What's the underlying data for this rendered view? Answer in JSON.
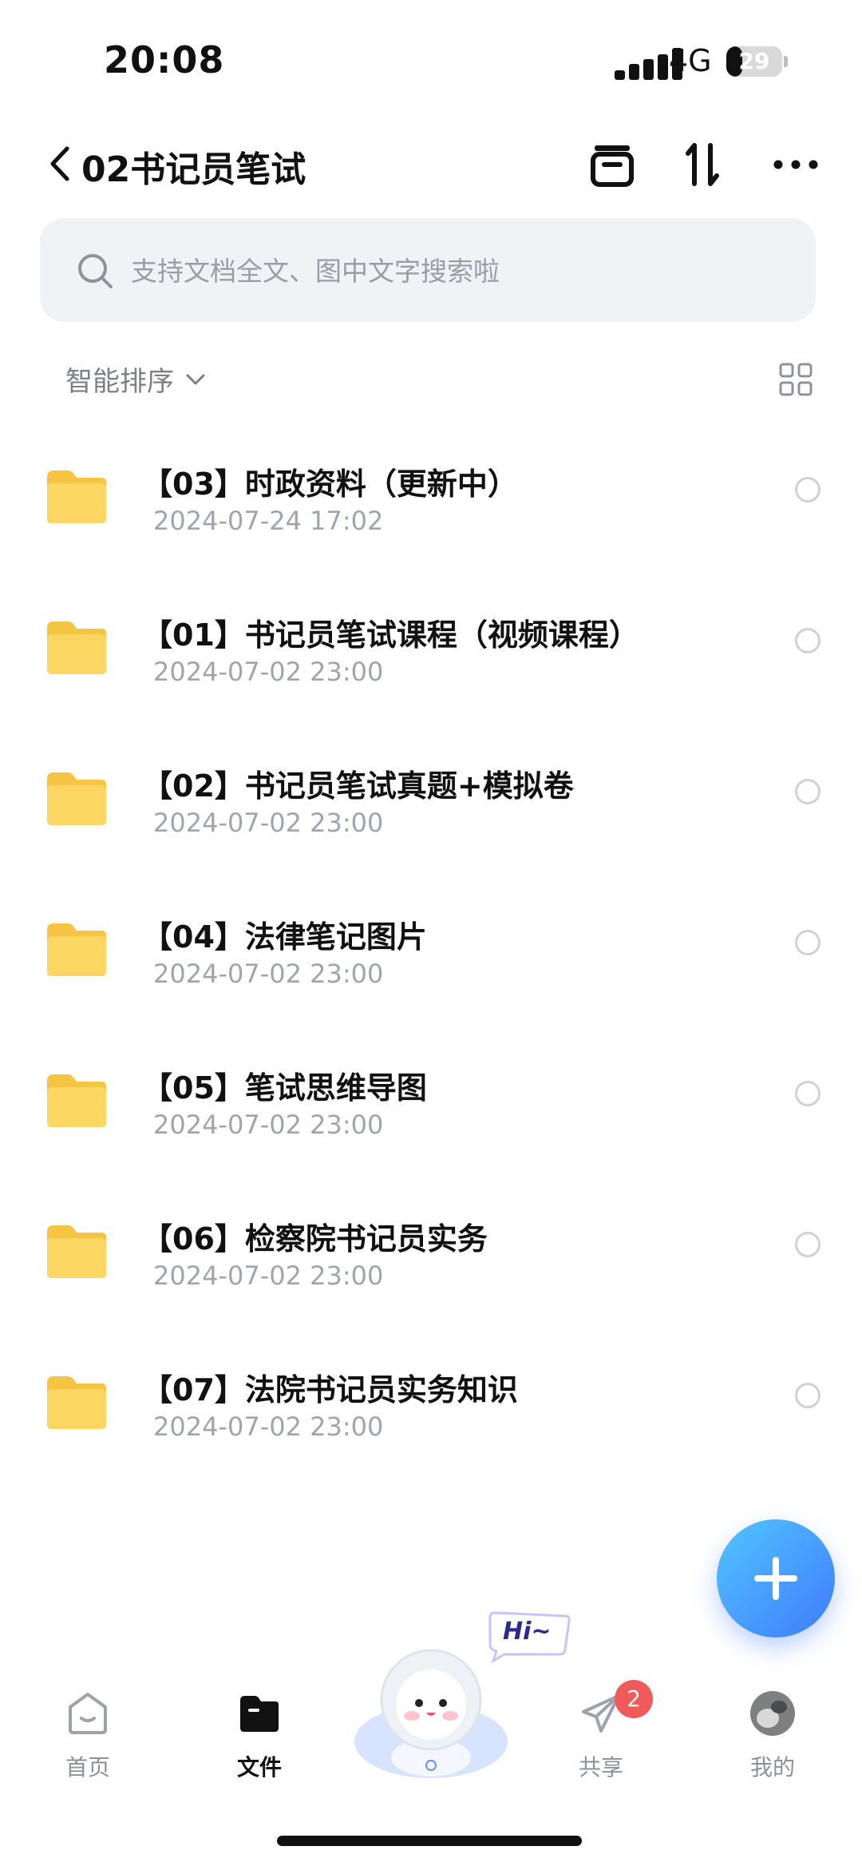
{
  "status_bar": {
    "time": "20:08",
    "network": "4G",
    "battery": "29",
    "battery_fraction": 0.29
  },
  "header": {
    "title": "02书记员笔试",
    "icons": [
      "back-icon",
      "archive-icon",
      "sort-icon",
      "more-icon"
    ]
  },
  "search": {
    "placeholder": "支持文档全文、图中文字搜索啦"
  },
  "sort": {
    "label": "智能排序"
  },
  "files": [
    {
      "name": "【03】时政资料（更新中）",
      "date": "2024-07-24 17:02"
    },
    {
      "name": "【01】书记员笔试课程（视频课程）",
      "date": "2024-07-02 23:00"
    },
    {
      "name": "【02】书记员笔试真题+模拟卷",
      "date": "2024-07-02 23:00"
    },
    {
      "name": "【04】法律笔记图片",
      "date": "2024-07-02 23:00"
    },
    {
      "name": "【05】笔试思维导图",
      "date": "2024-07-02 23:00"
    },
    {
      "name": "【06】检察院书记员实务",
      "date": "2024-07-02 23:00"
    },
    {
      "name": "【07】法院书记员实务知识",
      "date": "2024-07-02 23:00"
    }
  ],
  "mascot": {
    "bubble_text": "Hi~"
  },
  "tabbar": {
    "home": "首页",
    "files": "文件",
    "share": "共享",
    "share_badge": "2",
    "me": "我的"
  },
  "colors": {
    "accent": "#3f7bff",
    "folder": "#f9cf55",
    "badge": "#f15a5a"
  }
}
